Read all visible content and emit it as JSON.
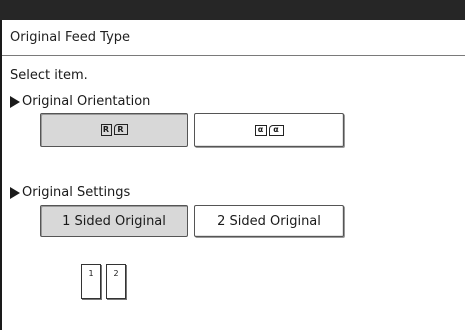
{
  "screen": {
    "title": "Original Feed Type",
    "prompt": "Select item."
  },
  "orientation": {
    "label": "Original Orientation",
    "options": [
      {
        "icon": "readable-direction-icon",
        "glyphs": [
          "R",
          "R"
        ],
        "selected": true
      },
      {
        "icon": "unreadable-direction-icon",
        "glyphs": [
          "α",
          "α"
        ],
        "selected": false
      }
    ]
  },
  "settings": {
    "label": "Original Settings",
    "options": [
      {
        "label": "1 Sided Original",
        "selected": true
      },
      {
        "label": "2 Sided Original",
        "selected": false
      }
    ]
  },
  "preview": {
    "pages": [
      "1",
      "2"
    ]
  },
  "colors": {
    "selected_fill": "#d8d8d8",
    "top_bar": "#262626"
  }
}
